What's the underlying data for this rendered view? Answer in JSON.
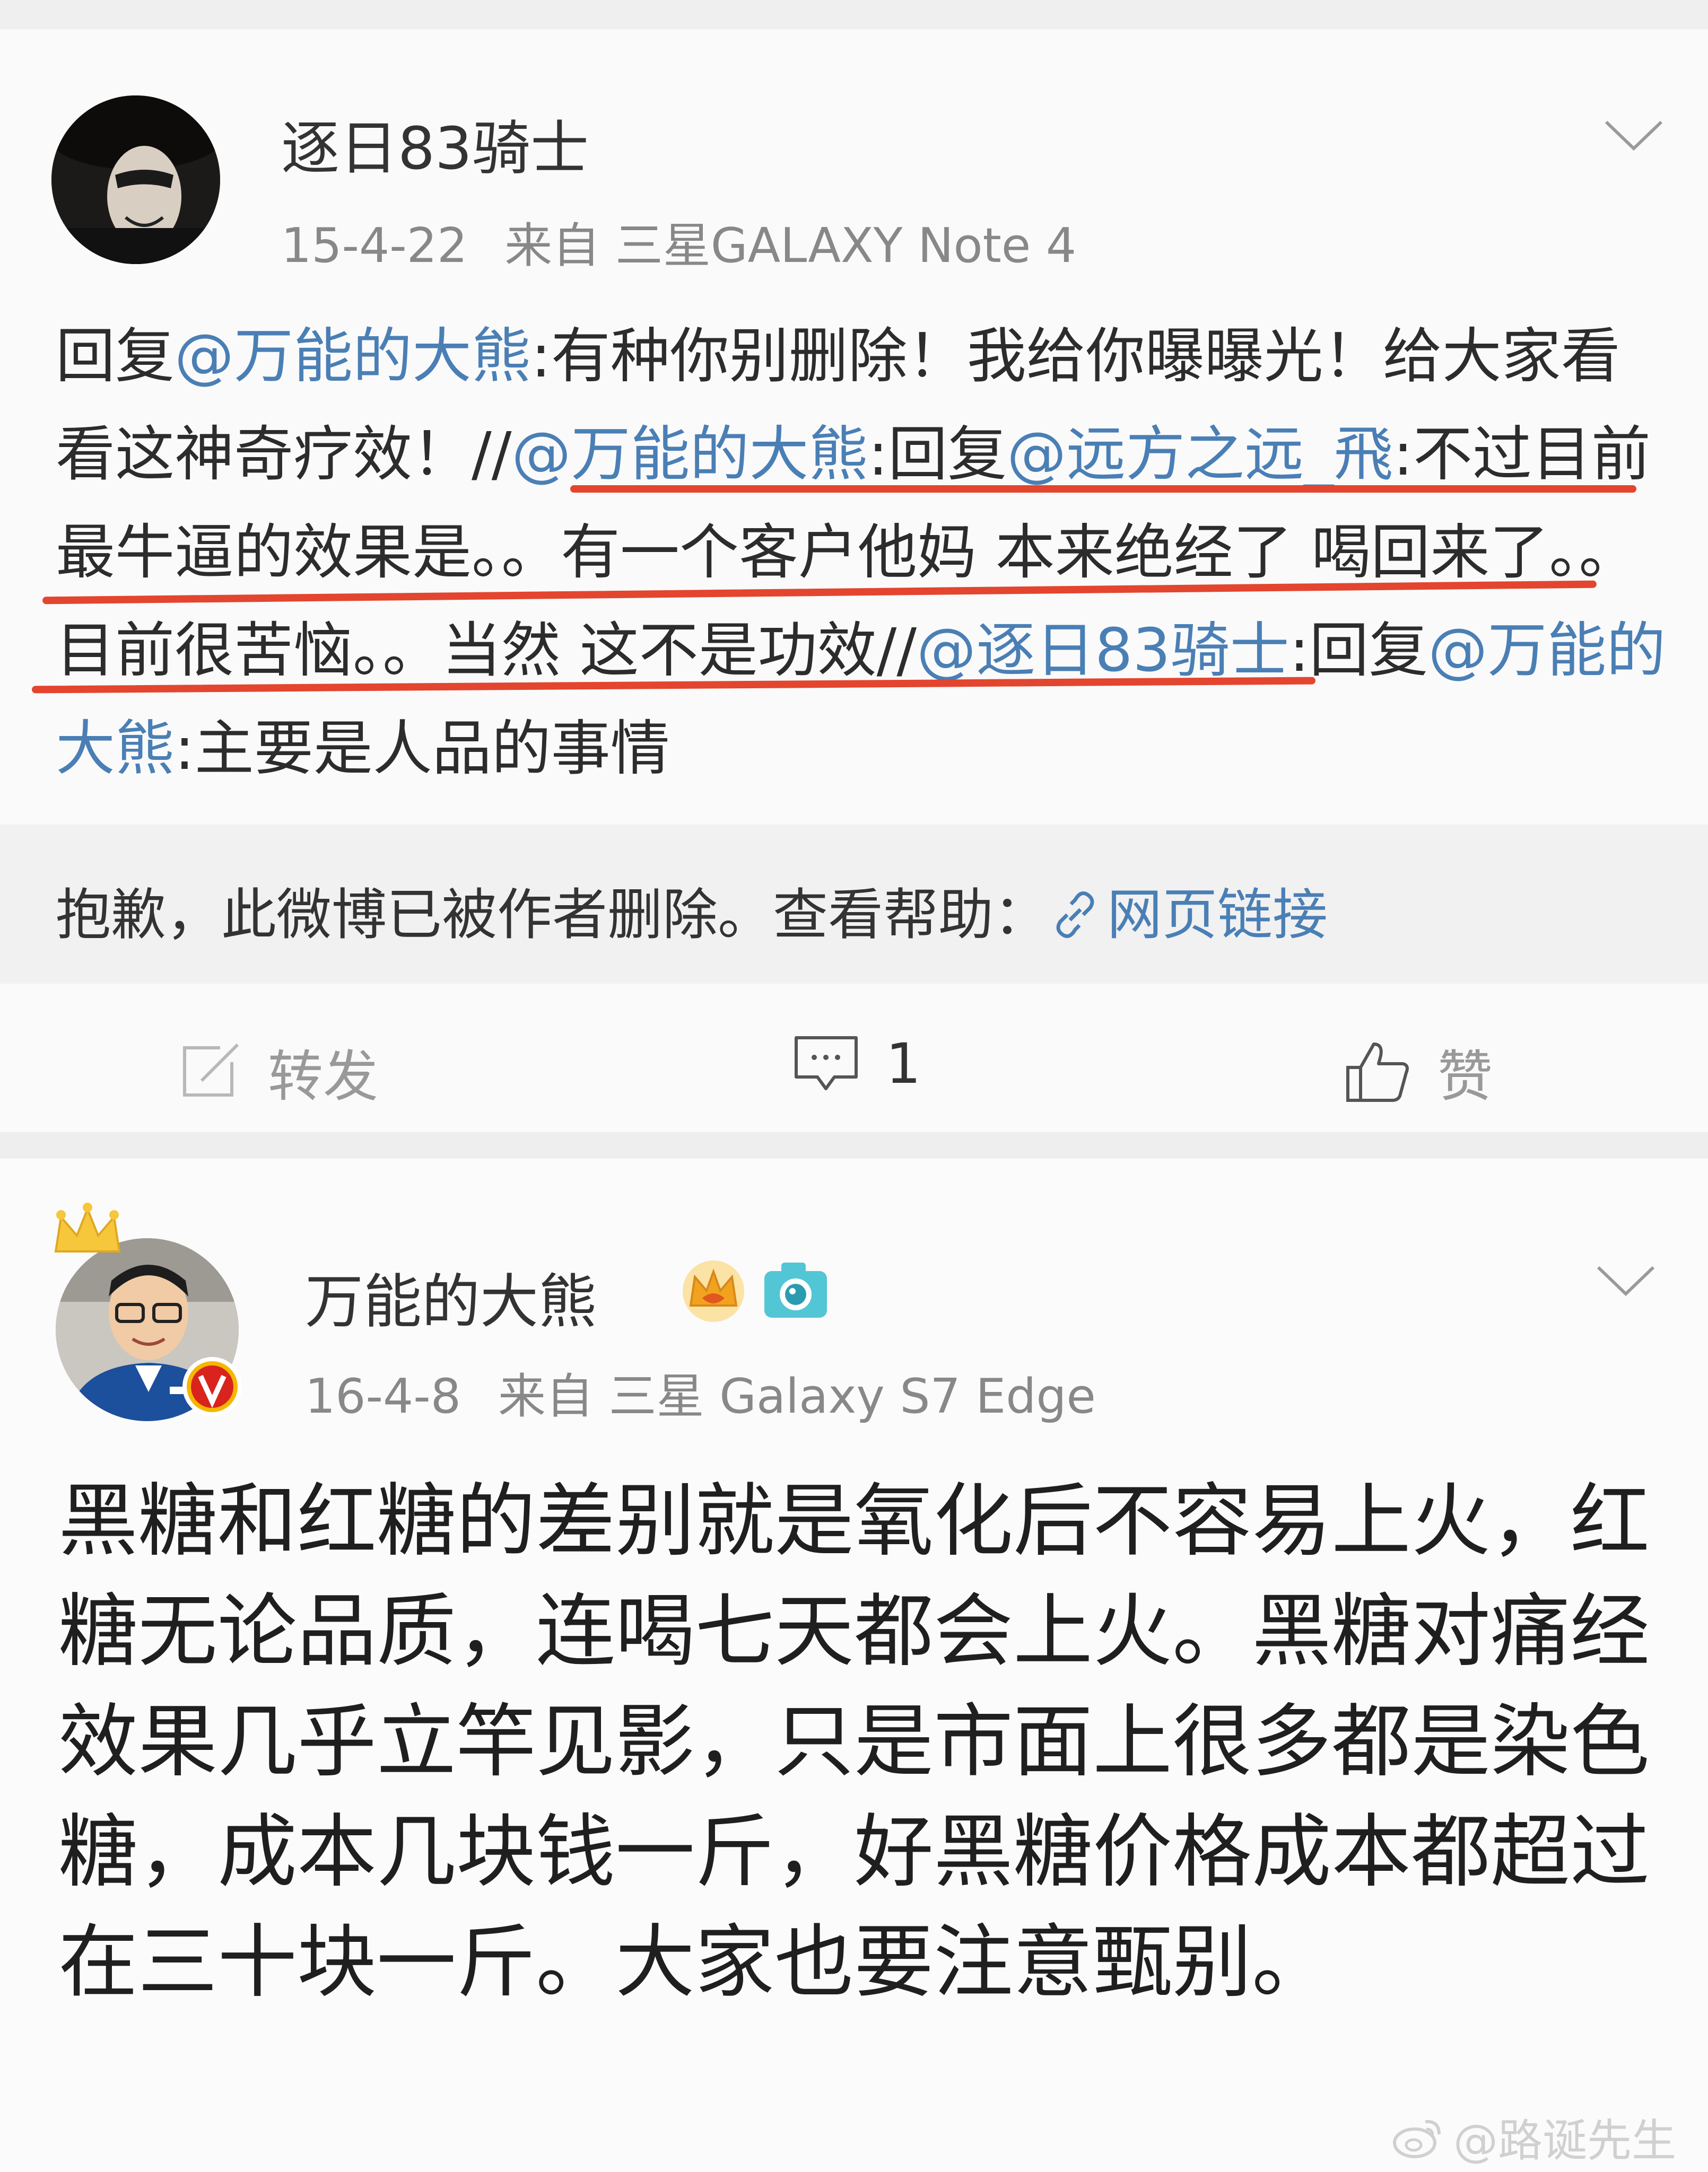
{
  "post1": {
    "username": "逐日83骑士",
    "date": "15-4-22",
    "source": "来自 三星GALAXY Note 4",
    "text_parts": [
      "回复",
      "@万能的大熊",
      ":有种你别删除！我给你曝曝光！给大家看看这神奇疗效！//",
      "@万能的大熊",
      ":回复",
      "@远方之远_飛",
      ":不过目前最牛逼的效果是。。有一个客户他妈 本来绝经了 喝回来了。。目前很苦恼。。当然 这不是功效//",
      "@逐日83骑士",
      ":回复",
      "@万能的大熊",
      ":主要是人品的事情"
    ],
    "deleted_notice": "抱歉，此微博已被作者删除。查看帮助：",
    "deleted_link": "网页链接",
    "actions": {
      "forward": "转发",
      "comment_count": "1",
      "like": "赞"
    }
  },
  "post2": {
    "username": "万能的大熊",
    "date": "16-4-8",
    "source": "来自 三星 Galaxy S7 Edge",
    "text": "黑糖和红糖的差别就是氧化后不容易上火，红糖无论品质，连喝七天都会上火。黑糖对痛经效果几乎立竿见影，只是市面上很多都是染色糖，成本几块钱一斤，好黑糖价格成本都超过在三十块一斤。大家也要注意甄别。"
  },
  "watermark": "@路诞先生",
  "colors": {
    "mention": "#4a7fb5",
    "underline": "#e3452f",
    "vip_badge": "#d9231d"
  }
}
